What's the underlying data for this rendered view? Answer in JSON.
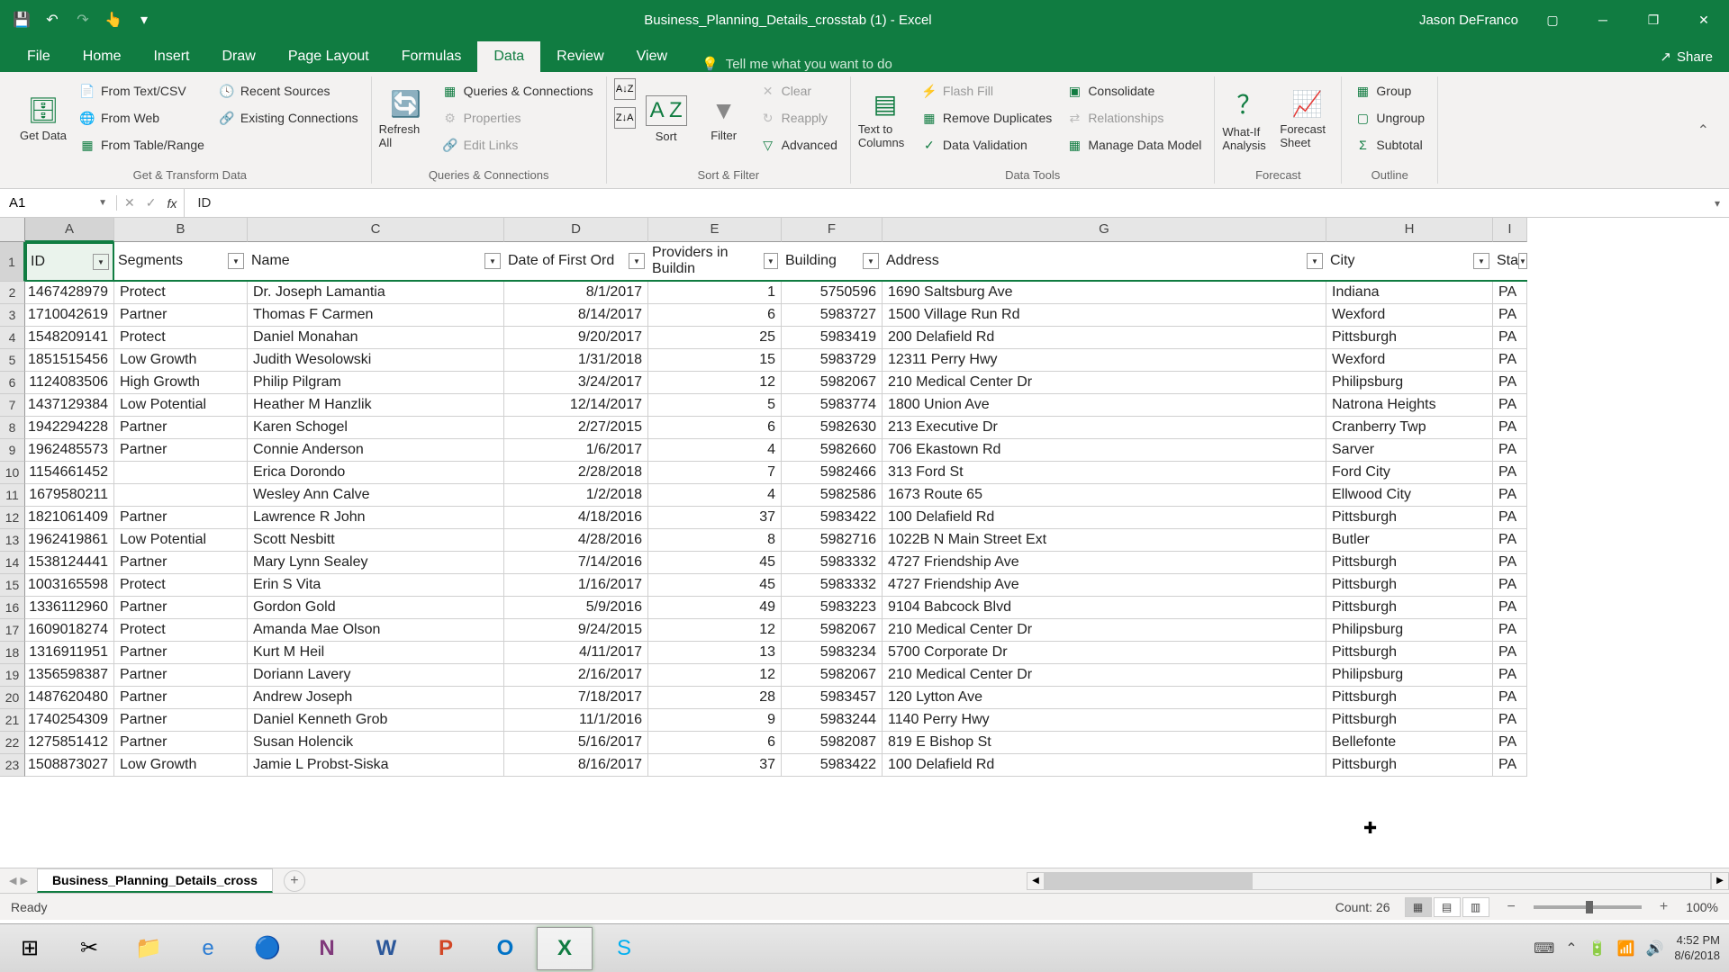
{
  "titlebar": {
    "doc_title": "Business_Planning_Details_crosstab (1) - Excel",
    "user": "Jason DeFranco"
  },
  "tabs": {
    "file": "File",
    "home": "Home",
    "insert": "Insert",
    "draw": "Draw",
    "page_layout": "Page Layout",
    "formulas": "Formulas",
    "data": "Data",
    "review": "Review",
    "view": "View",
    "tell_me": "Tell me what you want to do",
    "share": "Share"
  },
  "ribbon": {
    "get_data": "Get Data",
    "from_text": "From Text/CSV",
    "from_web": "From Web",
    "from_table": "From Table/Range",
    "recent": "Recent Sources",
    "existing": "Existing Connections",
    "group1": "Get & Transform Data",
    "refresh": "Refresh All",
    "queries": "Queries & Connections",
    "properties": "Properties",
    "edit_links": "Edit Links",
    "group2": "Queries & Connections",
    "sort": "Sort",
    "filter": "Filter",
    "clear": "Clear",
    "reapply": "Reapply",
    "advanced": "Advanced",
    "group3": "Sort & Filter",
    "text_cols": "Text to Columns",
    "flash": "Flash Fill",
    "dup": "Remove Duplicates",
    "validation": "Data Validation",
    "consolidate": "Consolidate",
    "relationships": "Relationships",
    "data_model": "Manage Data Model",
    "group4": "Data Tools",
    "whatif": "What-If Analysis",
    "forecast": "Forecast Sheet",
    "group5": "Forecast",
    "grp": "Group",
    "ungroup": "Ungroup",
    "subtotal": "Subtotal",
    "group6": "Outline"
  },
  "formula_bar": {
    "name_box": "A1",
    "value": "ID"
  },
  "columns": [
    "A",
    "B",
    "C",
    "D",
    "E",
    "F",
    "G",
    "H",
    "I"
  ],
  "headers": [
    "ID",
    "Segments",
    "Name",
    "Date of First Order",
    "Providers in Building",
    "Building",
    "Address",
    "City",
    "State"
  ],
  "rows": [
    [
      "1467428979",
      "Protect",
      "Dr. Joseph Lamantia",
      "8/1/2017",
      "1",
      "5750596",
      "1690 Saltsburg Ave",
      "Indiana",
      "PA"
    ],
    [
      "1710042619",
      "Partner",
      "Thomas F Carmen",
      "8/14/2017",
      "6",
      "5983727",
      "1500 Village Run Rd",
      "Wexford",
      "PA"
    ],
    [
      "1548209141",
      "Protect",
      "Daniel Monahan",
      "9/20/2017",
      "25",
      "5983419",
      "200 Delafield Rd",
      "Pittsburgh",
      "PA"
    ],
    [
      "1851515456",
      "Low Growth",
      "Judith Wesolowski",
      "1/31/2018",
      "15",
      "5983729",
      "12311 Perry Hwy",
      "Wexford",
      "PA"
    ],
    [
      "1124083506",
      "High Growth",
      "Philip Pilgram",
      "3/24/2017",
      "12",
      "5982067",
      "210 Medical Center Dr",
      "Philipsburg",
      "PA"
    ],
    [
      "1437129384",
      "Low Potential",
      "Heather M Hanzlik",
      "12/14/2017",
      "5",
      "5983774",
      "1800 Union Ave",
      "Natrona Heights",
      "PA"
    ],
    [
      "1942294228",
      "Partner",
      "Karen Schogel",
      "2/27/2015",
      "6",
      "5982630",
      "213 Executive Dr",
      "Cranberry Twp",
      "PA"
    ],
    [
      "1962485573",
      "Partner",
      "Connie Anderson",
      "1/6/2017",
      "4",
      "5982660",
      "706 Ekastown Rd",
      "Sarver",
      "PA"
    ],
    [
      "1154661452",
      "",
      "Erica Dorondo",
      "2/28/2018",
      "7",
      "5982466",
      "313 Ford St",
      "Ford City",
      "PA"
    ],
    [
      "1679580211",
      "",
      "Wesley Ann Calve",
      "1/2/2018",
      "4",
      "5982586",
      "1673 Route 65",
      "Ellwood City",
      "PA"
    ],
    [
      "1821061409",
      "Partner",
      "Lawrence R John",
      "4/18/2016",
      "37",
      "5983422",
      "100 Delafield Rd",
      "Pittsburgh",
      "PA"
    ],
    [
      "1962419861",
      "Low Potential",
      "Scott Nesbitt",
      "4/28/2016",
      "8",
      "5982716",
      "1022B N Main Street Ext",
      "Butler",
      "PA"
    ],
    [
      "1538124441",
      "Partner",
      "Mary Lynn Sealey",
      "7/14/2016",
      "45",
      "5983332",
      "4727 Friendship Ave",
      "Pittsburgh",
      "PA"
    ],
    [
      "1003165598",
      "Protect",
      "Erin S Vita",
      "1/16/2017",
      "45",
      "5983332",
      "4727 Friendship Ave",
      "Pittsburgh",
      "PA"
    ],
    [
      "1336112960",
      "Partner",
      "Gordon Gold",
      "5/9/2016",
      "49",
      "5983223",
      "9104 Babcock Blvd",
      "Pittsburgh",
      "PA"
    ],
    [
      "1609018274",
      "Protect",
      "Amanda Mae Olson",
      "9/24/2015",
      "12",
      "5982067",
      "210 Medical Center Dr",
      "Philipsburg",
      "PA"
    ],
    [
      "1316911951",
      "Partner",
      "Kurt M Heil",
      "4/11/2017",
      "13",
      "5983234",
      "5700 Corporate Dr",
      "Pittsburgh",
      "PA"
    ],
    [
      "1356598387",
      "Partner",
      "Doriann Lavery",
      "2/16/2017",
      "12",
      "5982067",
      "210 Medical Center Dr",
      "Philipsburg",
      "PA"
    ],
    [
      "1487620480",
      "Partner",
      "Andrew Joseph",
      "7/18/2017",
      "28",
      "5983457",
      "120 Lytton Ave",
      "Pittsburgh",
      "PA"
    ],
    [
      "1740254309",
      "Partner",
      "Daniel Kenneth Grob",
      "11/1/2016",
      "9",
      "5983244",
      "1140 Perry Hwy",
      "Pittsburgh",
      "PA"
    ],
    [
      "1275851412",
      "Partner",
      "Susan Holencik",
      "5/16/2017",
      "6",
      "5982087",
      "819 E Bishop St",
      "Bellefonte",
      "PA"
    ],
    [
      "1508873027",
      "Low Growth",
      "Jamie L Probst-Siska",
      "8/16/2017",
      "37",
      "5983422",
      "100 Delafield Rd",
      "Pittsburgh",
      "PA"
    ]
  ],
  "sheet": {
    "name": "Business_Planning_Details_cross"
  },
  "status": {
    "ready": "Ready",
    "count": "Count: 26",
    "zoom": "100%"
  },
  "clock": {
    "time": "4:52 PM",
    "date": "8/6/2018"
  }
}
